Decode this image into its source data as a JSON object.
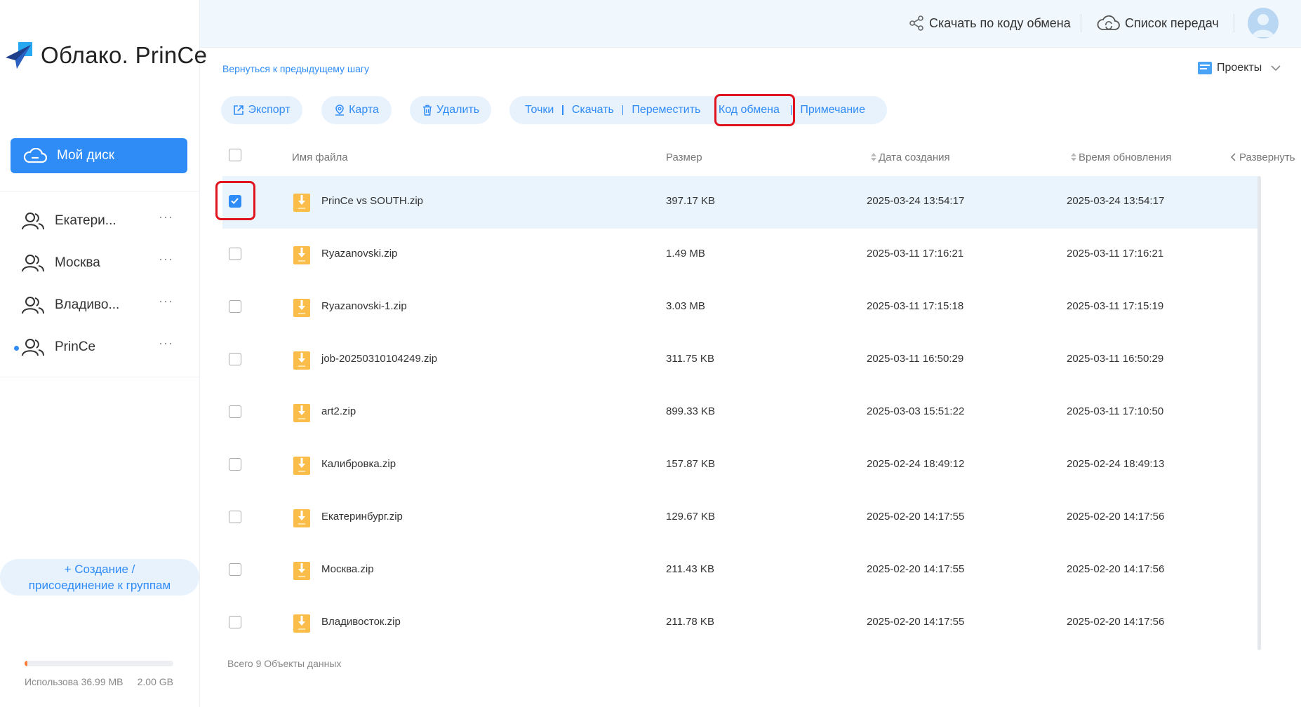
{
  "app": {
    "logo_text": "Облако. PrinCe"
  },
  "sidebar": {
    "my_disk_label": "Мой диск",
    "groups": [
      {
        "label": "Екатери...",
        "more": "···"
      },
      {
        "label": "Москва",
        "more": "···"
      },
      {
        "label": "Владиво...",
        "more": "···"
      },
      {
        "label": "PrinCe",
        "more": "···"
      }
    ],
    "create_line1": "+ Создание /",
    "create_line2": "присоединение к группам",
    "storage": {
      "used_label": "Использова 36.99 MB",
      "total_label": "2.00 GB",
      "used_fraction": 0.018
    }
  },
  "header": {
    "exchange_code_download": "Скачать по коду обмена",
    "transfer_list": "Список передач"
  },
  "nav": {
    "back_link": "Вернуться к предыдущему шагу",
    "projects_label": "Проекты"
  },
  "toolbar": {
    "export_label": "Экспорт",
    "map_label": "Карта",
    "delete_label": "Удалить",
    "points_label": "Точки",
    "download_label": "Скачать",
    "move_label": "Переместить",
    "exchange_code_label": "Код обмена",
    "note_label": "Примечание"
  },
  "table": {
    "columns": {
      "name": "Имя файла",
      "size": "Размер",
      "created": "Дата создания",
      "updated": "Время обновления",
      "expand": "Развернуть"
    },
    "rows": [
      {
        "name": "PrinCe vs SOUTH.zip",
        "size": "397.17 KB",
        "created": "2025-03-24 13:54:17",
        "updated": "2025-03-24 13:54:17",
        "selected": true
      },
      {
        "name": "Ryazanovski.zip",
        "size": "1.49 MB",
        "created": "2025-03-11 17:16:21",
        "updated": "2025-03-11 17:16:21",
        "selected": false
      },
      {
        "name": "Ryazanovski-1.zip",
        "size": "3.03 MB",
        "created": "2025-03-11 17:15:18",
        "updated": "2025-03-11 17:15:19",
        "selected": false
      },
      {
        "name": "job-20250310104249.zip",
        "size": "311.75 KB",
        "created": "2025-03-11 16:50:29",
        "updated": "2025-03-11 16:50:29",
        "selected": false
      },
      {
        "name": "art2.zip",
        "size": "899.33 KB",
        "created": "2025-03-03 15:51:22",
        "updated": "2025-03-11 17:10:50",
        "selected": false
      },
      {
        "name": "Калибровка.zip",
        "size": "157.87 KB",
        "created": "2025-02-24 18:49:12",
        "updated": "2025-02-24 18:49:13",
        "selected": false
      },
      {
        "name": "Екатеринбург.zip",
        "size": "129.67 KB",
        "created": "2025-02-20 14:17:55",
        "updated": "2025-02-20 14:17:56",
        "selected": false
      },
      {
        "name": "Москва.zip",
        "size": "211.43 KB",
        "created": "2025-02-20 14:17:55",
        "updated": "2025-02-20 14:17:56",
        "selected": false
      },
      {
        "name": "Владивосток.zip",
        "size": "211.78 KB",
        "created": "2025-02-20 14:17:55",
        "updated": "2025-02-20 14:17:56",
        "selected": false
      }
    ],
    "footer": "Всего 9 Объекты данных"
  },
  "colors": {
    "accent": "#2f8cf7",
    "highlight": "#e0141e",
    "selected_row": "#e9f4fd",
    "zip_icon": "#fbbd4a"
  },
  "icons": {
    "logo": "paper-plane-logo-icon",
    "my_disk": "cloud-icon",
    "group": "users-icon",
    "exchange": "share-icon",
    "transfer": "cloud-sync-icon",
    "export": "export-icon",
    "map": "map-pin-icon",
    "delete": "trash-icon",
    "projects": "projects-icon",
    "file": "zip-file-icon"
  }
}
